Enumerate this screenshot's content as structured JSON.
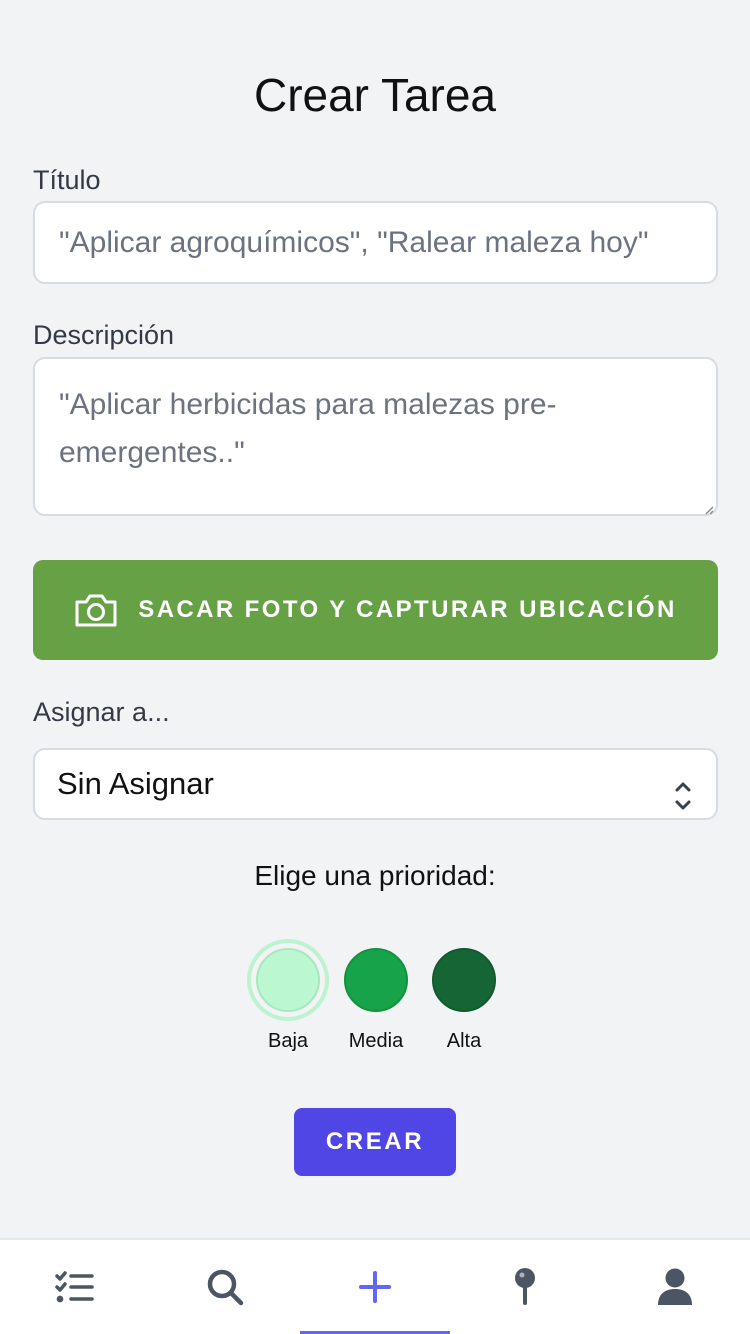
{
  "page": {
    "title": "Crear Tarea"
  },
  "form": {
    "titulo_label": "Título",
    "titulo_placeholder": "\"Aplicar agroquímicos\", \"Ralear maleza hoy\"",
    "descripcion_label": "Descripción",
    "descripcion_placeholder": "\"Aplicar herbicidas para malezas pre-emergentes..\"",
    "photo_button_label": "SACAR FOTO Y CAPTURAR UBICACIÓN",
    "assign_label": "Asignar a...",
    "assign_selected": "Sin Asignar",
    "priority_label": "Elige una prioridad:",
    "priorities": [
      {
        "label": "Baja",
        "color": "#bbf7d0",
        "selected": true
      },
      {
        "label": "Media",
        "color": "#16a34a",
        "selected": false
      },
      {
        "label": "Alta",
        "color": "#166534",
        "selected": false
      }
    ],
    "create_button_label": "CREAR"
  },
  "nav": {
    "items": [
      {
        "icon": "task-list-icon",
        "active": false
      },
      {
        "icon": "search-icon",
        "active": false
      },
      {
        "icon": "plus-icon",
        "active": true
      },
      {
        "icon": "map-pin-icon",
        "active": false
      },
      {
        "icon": "user-icon",
        "active": false
      }
    ],
    "active_color": "#6366f1",
    "icon_color": "#4b5563"
  },
  "colors": {
    "photo_button": "#67a145",
    "create_button": "#4f46e5",
    "background": "#f2f3f5"
  }
}
